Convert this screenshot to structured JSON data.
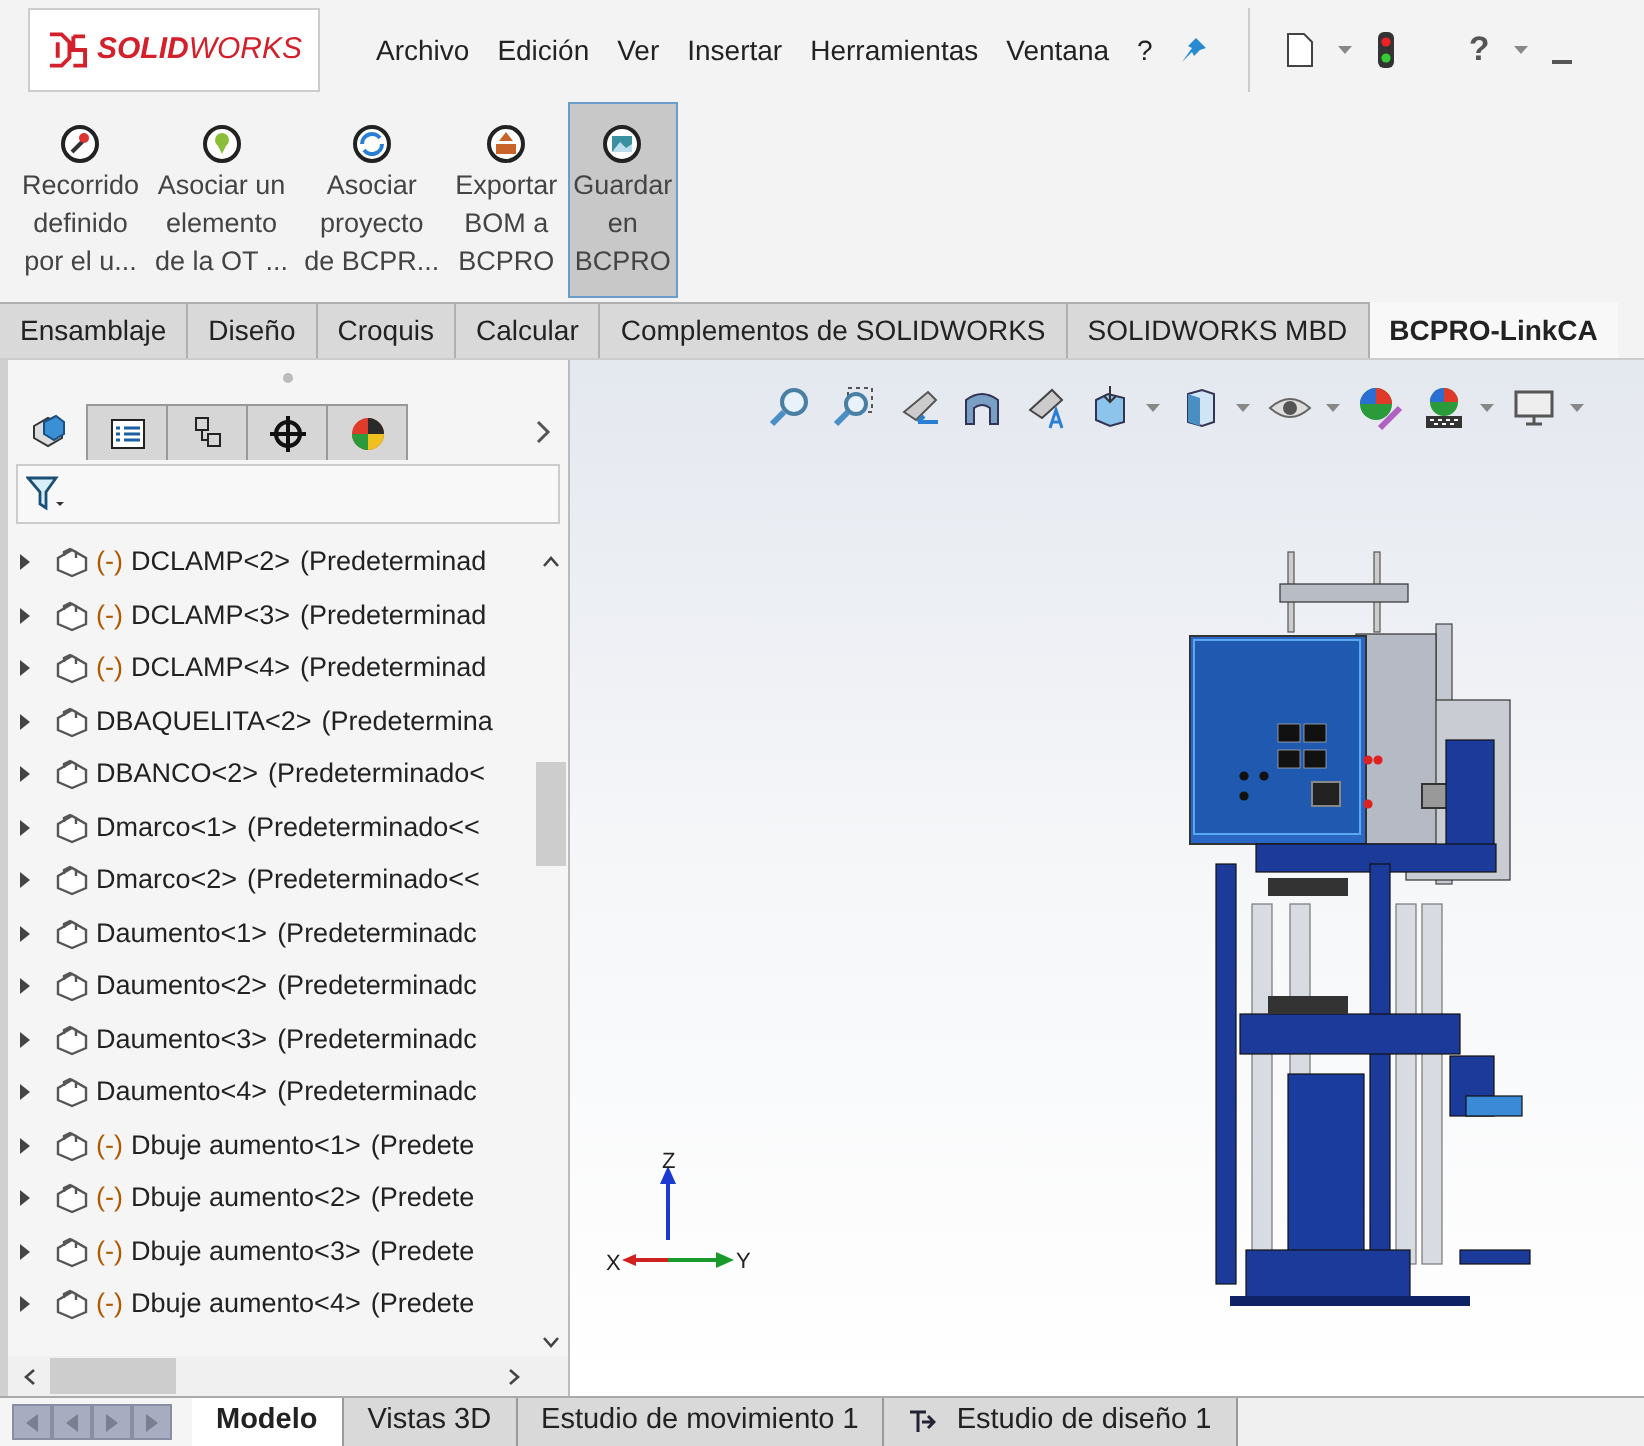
{
  "logo": {
    "text": "**SOLID**WORKS"
  },
  "menu": [
    "Archivo",
    "Edición",
    "Ver",
    "Insertar",
    "Herramientas",
    "Ventana",
    "?"
  ],
  "title_tools": {
    "help": "?"
  },
  "ribbon": [
    {
      "kind": "route",
      "lines": [
        "Recorrido",
        "definido",
        "por el u..."
      ],
      "selected": false
    },
    {
      "kind": "pin",
      "lines": [
        "Asociar un",
        "elemento",
        "de la OT ..."
      ],
      "selected": false
    },
    {
      "kind": "sync",
      "lines": [
        "Asociar",
        "proyecto",
        "de BCPR..."
      ],
      "selected": false
    },
    {
      "kind": "export",
      "lines": [
        "Exportar",
        "BOM a",
        "BCPRO"
      ],
      "selected": false
    },
    {
      "kind": "save",
      "lines": [
        "Guardar",
        "en",
        "BCPRO"
      ],
      "selected": true
    }
  ],
  "tabs": [
    {
      "label": "Ensamblaje",
      "selected": false
    },
    {
      "label": "Diseño",
      "selected": false
    },
    {
      "label": "Croquis",
      "selected": false
    },
    {
      "label": "Calcular",
      "selected": false
    },
    {
      "label": "Complementos de SOLIDWORKS",
      "selected": false
    },
    {
      "label": "SOLIDWORKS MBD",
      "selected": false
    },
    {
      "label": "BCPRO-LinkCA",
      "selected": true
    }
  ],
  "panel_tabs": [
    {
      "kind": "tree",
      "selected": true
    },
    {
      "kind": "properties",
      "selected": false
    },
    {
      "kind": "config",
      "selected": false
    },
    {
      "kind": "target",
      "selected": false
    },
    {
      "kind": "appearance",
      "selected": false
    }
  ],
  "tree": [
    {
      "prefix": "(-)",
      "name": "DCLAMP<2>",
      "config": "(Predeterminad"
    },
    {
      "prefix": "(-)",
      "name": "DCLAMP<3>",
      "config": "(Predeterminad"
    },
    {
      "prefix": "(-)",
      "name": "DCLAMP<4>",
      "config": "(Predeterminad"
    },
    {
      "name": "DBAQUELITA<2>",
      "config": "(Predetermina"
    },
    {
      "name": "DBANCO<2>",
      "config": "(Predeterminado<"
    },
    {
      "name": "Dmarco<1>",
      "config": "(Predeterminado<<"
    },
    {
      "name": "Dmarco<2>",
      "config": "(Predeterminado<<"
    },
    {
      "name": "Daumento<1>",
      "config": "(Predeterminadc"
    },
    {
      "name": "Daumento<2>",
      "config": "(Predeterminadc"
    },
    {
      "name": "Daumento<3>",
      "config": "(Predeterminadc"
    },
    {
      "name": "Daumento<4>",
      "config": "(Predeterminadc"
    },
    {
      "prefix": "(-)",
      "name": "Dbuje aumento<1>",
      "config": "(Predete"
    },
    {
      "prefix": "(-)",
      "name": "Dbuje aumento<2>",
      "config": "(Predete"
    },
    {
      "prefix": "(-)",
      "name": "Dbuje aumento<3>",
      "config": "(Predete"
    },
    {
      "prefix": "(-)",
      "name": "Dbuje aumento<4>",
      "config": "(Predete"
    }
  ],
  "view_tools": [
    {
      "kind": "zoom-fit",
      "dropdown": false
    },
    {
      "kind": "zoom-area",
      "dropdown": false
    },
    {
      "kind": "previous",
      "dropdown": false
    },
    {
      "kind": "section",
      "dropdown": false
    },
    {
      "kind": "dynamic",
      "dropdown": false
    },
    {
      "kind": "orientation",
      "dropdown": true
    },
    {
      "kind": "display",
      "dropdown": true
    },
    {
      "kind": "hide",
      "dropdown": true
    },
    {
      "kind": "edit-appearance",
      "dropdown": false
    },
    {
      "kind": "scene",
      "dropdown": true
    },
    {
      "kind": "settings",
      "dropdown": true
    }
  ],
  "triad": {
    "x": "X",
    "y": "Y",
    "z": "Z"
  },
  "bottom_tabs": [
    {
      "label": "Modelo",
      "selected": true,
      "kind": "plain"
    },
    {
      "label": "Vistas 3D",
      "selected": false,
      "kind": "plain"
    },
    {
      "label": "Estudio de movimiento 1",
      "selected": false,
      "kind": "plain"
    },
    {
      "label": "Estudio de diseño 1",
      "selected": false,
      "kind": "study"
    }
  ]
}
